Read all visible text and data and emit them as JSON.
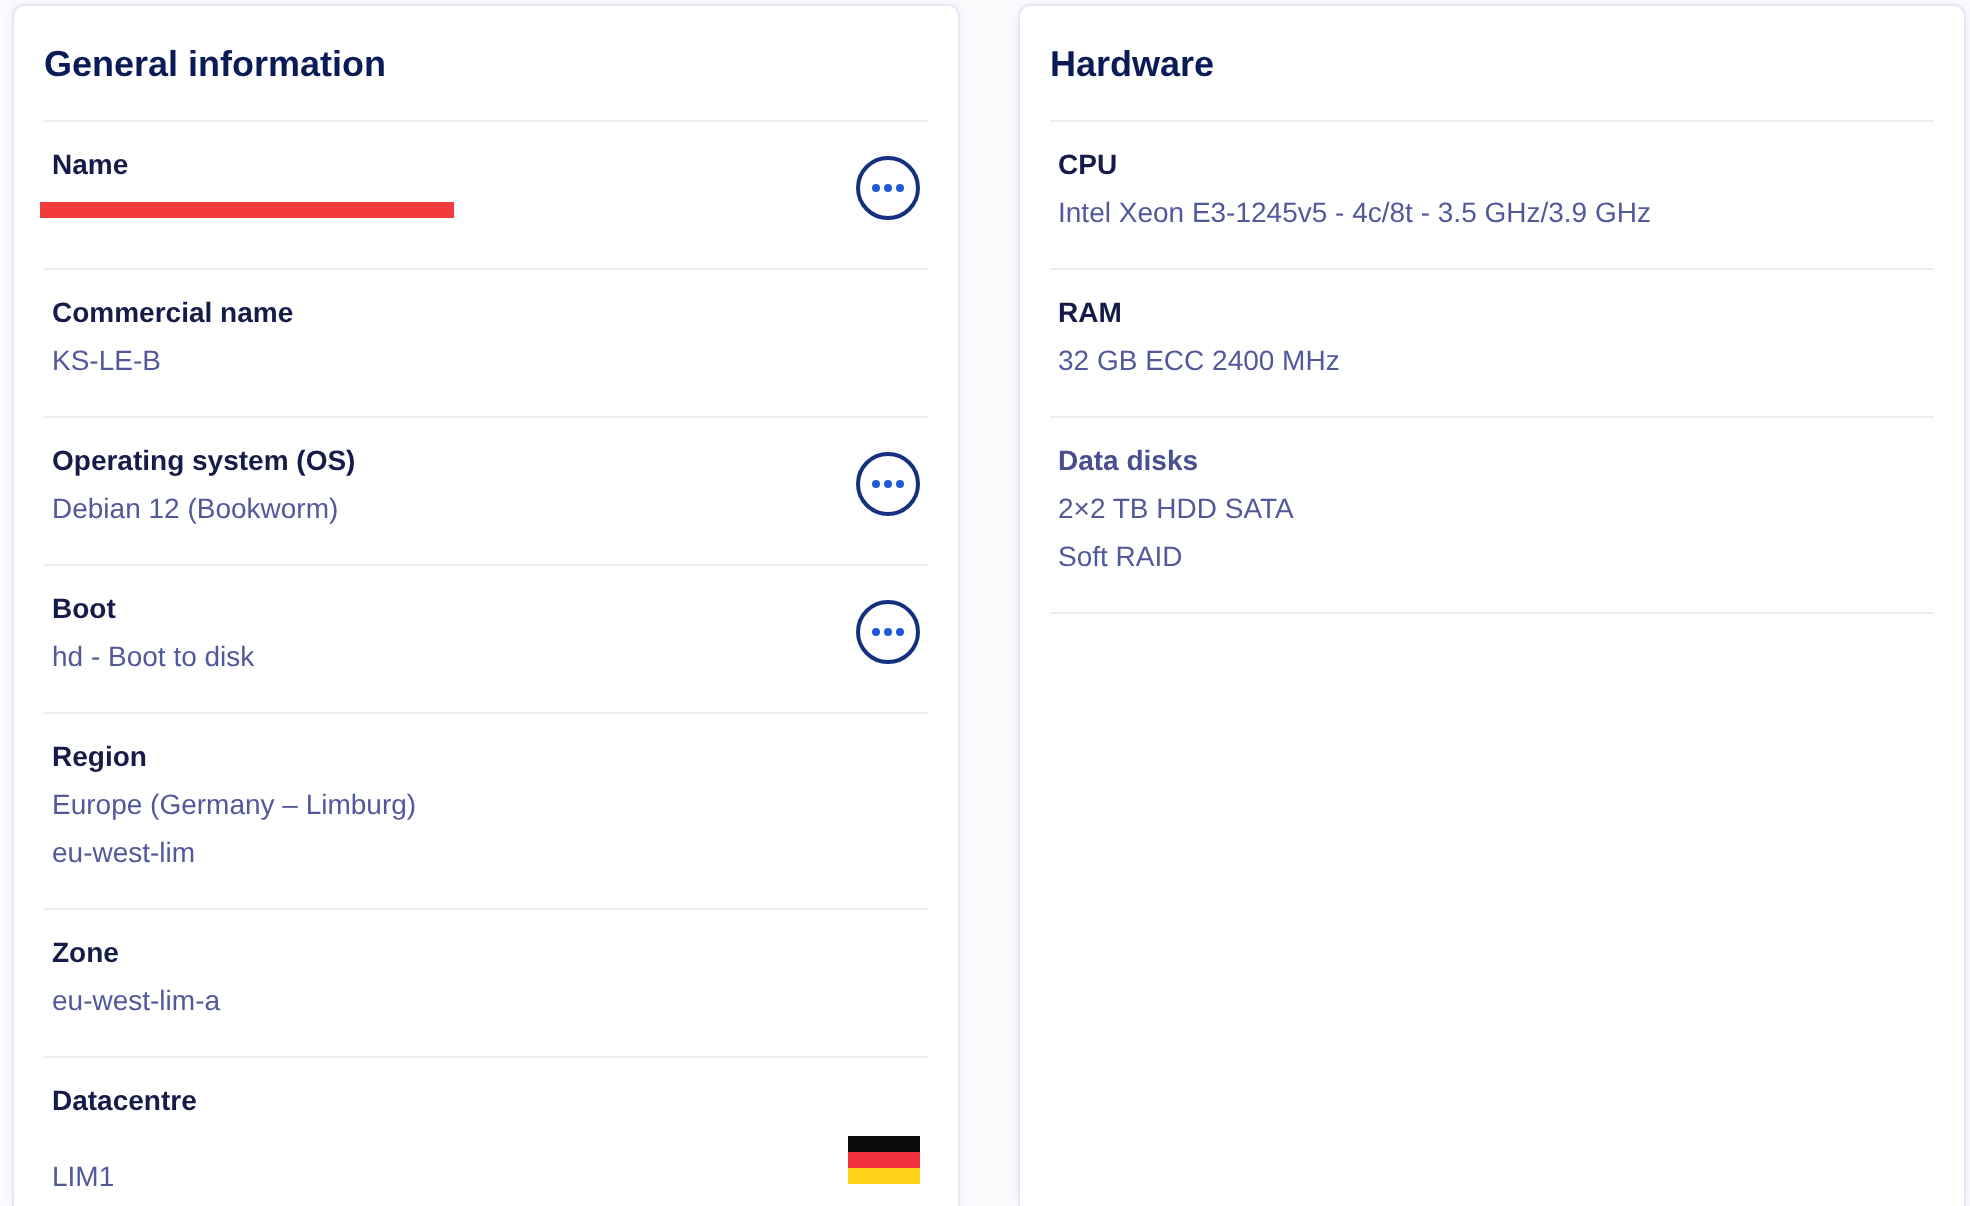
{
  "cards": [
    {
      "title": "General information",
      "items": [
        {
          "label": "Name",
          "redacted": true,
          "menu": true,
          "flag": false
        },
        {
          "label": "Commercial name",
          "values": [
            "KS-LE-B"
          ],
          "redacted": false,
          "menu": false,
          "flag": false
        },
        {
          "label": "Operating system (OS)",
          "values": [
            "Debian 12 (Bookworm)"
          ],
          "redacted": false,
          "menu": true,
          "flag": false
        },
        {
          "label": "Boot",
          "values": [
            "hd - Boot to disk"
          ],
          "redacted": false,
          "menu": true,
          "flag": false
        },
        {
          "label": "Region",
          "values": [
            "Europe (Germany – Limburg)",
            "eu-west-lim"
          ],
          "redacted": false,
          "menu": false,
          "flag": false
        },
        {
          "label": "Zone",
          "values": [
            "eu-west-lim-a"
          ],
          "redacted": false,
          "menu": false,
          "flag": false
        },
        {
          "label": "Datacentre",
          "values": [
            "LIM1"
          ],
          "redacted": false,
          "menu": false,
          "flag": true
        }
      ]
    },
    {
      "title": "Hardware",
      "items": [
        {
          "label": "CPU",
          "values": [
            "Intel Xeon E3-1245v5 - 4c/8t - 3.5 GHz/3.9 GHz"
          ],
          "dim_label": false
        },
        {
          "label": "RAM",
          "values": [
            "32 GB ECC 2400 MHz"
          ],
          "dim_label": false
        },
        {
          "label": "Data disks",
          "values": [
            "2×2 TB HDD SATA",
            "Soft RAID"
          ],
          "dim_label": true
        }
      ]
    }
  ]
}
